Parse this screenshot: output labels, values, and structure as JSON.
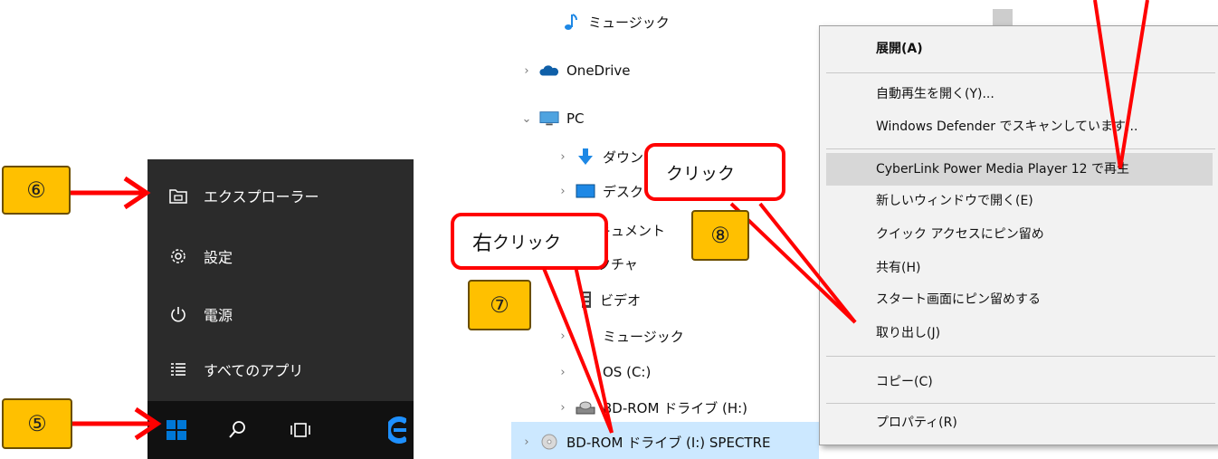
{
  "start_menu": {
    "items": [
      {
        "label": "エクスプローラー",
        "icon": "file-explorer-icon"
      },
      {
        "label": "設定",
        "icon": "gear-icon"
      },
      {
        "label": "電源",
        "icon": "power-icon"
      },
      {
        "label": "すべてのアプリ",
        "icon": "all-apps-icon"
      }
    ]
  },
  "taskbar": {
    "buttons": [
      "windows-start-icon",
      "search-icon",
      "task-view-icon",
      "edge-icon"
    ]
  },
  "explorer_tree": {
    "items": [
      {
        "label": "ミュージック",
        "icon": "music-note-icon"
      },
      {
        "label": "OneDrive",
        "icon": "onedrive-cloud-icon"
      },
      {
        "label": "PC",
        "icon": "pc-monitor-icon"
      },
      {
        "label": "ダウン",
        "icon": "downloads-icon"
      },
      {
        "label": "デスク",
        "icon": "desktop-icon"
      },
      {
        "label": "ドキュメント",
        "icon": "documents-icon"
      },
      {
        "label": "ピクチャ",
        "icon": "pictures-icon"
      },
      {
        "label": "ビデオ",
        "icon": "videos-icon"
      },
      {
        "label": "ミュージック",
        "icon": "music-note-icon"
      },
      {
        "label": "OS (C:)",
        "icon": "drive-icon"
      },
      {
        "label": "BD-ROM ドライブ (H:)",
        "icon": "optical-drive-icon"
      },
      {
        "label": "BD-ROM ドライブ (I:) SPECTRE",
        "icon": "disc-icon"
      }
    ]
  },
  "context_menu": {
    "items": [
      "展開(A)",
      "自動再生を開く(Y)...",
      "Windows Defender でスキャンしています...",
      "CyberLink Power Media Player 12 で再生",
      "新しいウィンドウで開く(E)",
      "クイック アクセスにピン留め",
      "共有(H)",
      "スタート画面にピン留めする",
      "取り出し(J)",
      "コピー(C)",
      "プロパティ(R)"
    ]
  },
  "annotations": {
    "step5": "⑤",
    "step6": "⑥",
    "step7": "⑦",
    "step8": "⑧",
    "right_click_prefix": "右",
    "right_click_suffix": "クリック",
    "click": "クリック"
  },
  "colors": {
    "annotation_red": "#ff0000",
    "step_box": "#ffc000",
    "start_menu_bg": "#2b2b2b",
    "taskbar_bg": "#111111",
    "selection": "#cce8ff",
    "menu_highlight": "#d7d7d7",
    "windows_blue": "#0078d7"
  }
}
